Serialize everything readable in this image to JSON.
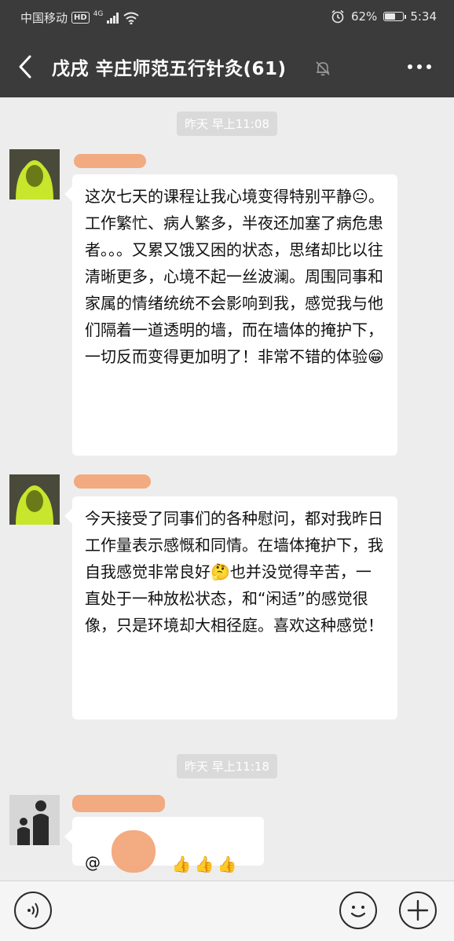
{
  "status_bar": {
    "carrier": "中国移动",
    "hd": "HD",
    "network": "4G",
    "battery_percent_text": "62%",
    "battery_level": 0.62,
    "time": "5:34"
  },
  "header": {
    "title": "戊戌 辛庄师范五行针灸(61)"
  },
  "messages": [
    {
      "timestamp": "昨天 早上11:08",
      "text": "这次七天的课程让我心境变得特别平静😐。工作繁忙、病人繁多，半夜还加塞了病危患者。。。又累又饿又困的状态，思绪却比以往清晰更多，心境不起一丝波澜。周围同事和家属的情绪统统不会影响到我，感觉我与他们隔着一道透明的墙，而在墙体的掩护下，一切反而变得更加明了！非常不错的体验😁"
    },
    {
      "text": "今天接受了同事们的各种慰问，都对我昨日工作量表示感慨和同情。在墙体掩护下，我自我感觉非常良好🤔也并没觉得辛苦，一直处于一种放松状态，和“闲适”的感觉很像，只是环境却大相径庭。喜欢这种感觉！"
    },
    {
      "timestamp": "昨天 早上11:18",
      "text": "@",
      "thumbs": [
        "👍",
        "👍",
        "👍"
      ]
    }
  ],
  "colors": {
    "header_bg": "#3b3b3b",
    "chat_bg": "#ededed",
    "bubble_bg": "#ffffff",
    "redaction": "#f2a77a"
  }
}
